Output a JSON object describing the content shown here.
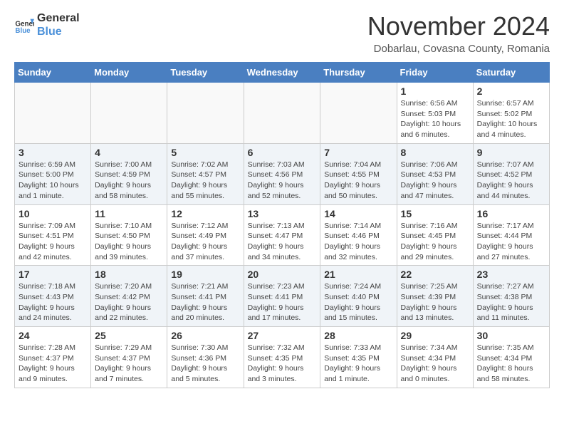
{
  "logo": {
    "line1": "General",
    "line2": "Blue"
  },
  "title": "November 2024",
  "location": "Dobarlau, Covasna County, Romania",
  "days_of_week": [
    "Sunday",
    "Monday",
    "Tuesday",
    "Wednesday",
    "Thursday",
    "Friday",
    "Saturday"
  ],
  "weeks": [
    [
      {
        "day": "",
        "info": ""
      },
      {
        "day": "",
        "info": ""
      },
      {
        "day": "",
        "info": ""
      },
      {
        "day": "",
        "info": ""
      },
      {
        "day": "",
        "info": ""
      },
      {
        "day": "1",
        "info": "Sunrise: 6:56 AM\nSunset: 5:03 PM\nDaylight: 10 hours and 6 minutes."
      },
      {
        "day": "2",
        "info": "Sunrise: 6:57 AM\nSunset: 5:02 PM\nDaylight: 10 hours and 4 minutes."
      }
    ],
    [
      {
        "day": "3",
        "info": "Sunrise: 6:59 AM\nSunset: 5:00 PM\nDaylight: 10 hours and 1 minute."
      },
      {
        "day": "4",
        "info": "Sunrise: 7:00 AM\nSunset: 4:59 PM\nDaylight: 9 hours and 58 minutes."
      },
      {
        "day": "5",
        "info": "Sunrise: 7:02 AM\nSunset: 4:57 PM\nDaylight: 9 hours and 55 minutes."
      },
      {
        "day": "6",
        "info": "Sunrise: 7:03 AM\nSunset: 4:56 PM\nDaylight: 9 hours and 52 minutes."
      },
      {
        "day": "7",
        "info": "Sunrise: 7:04 AM\nSunset: 4:55 PM\nDaylight: 9 hours and 50 minutes."
      },
      {
        "day": "8",
        "info": "Sunrise: 7:06 AM\nSunset: 4:53 PM\nDaylight: 9 hours and 47 minutes."
      },
      {
        "day": "9",
        "info": "Sunrise: 7:07 AM\nSunset: 4:52 PM\nDaylight: 9 hours and 44 minutes."
      }
    ],
    [
      {
        "day": "10",
        "info": "Sunrise: 7:09 AM\nSunset: 4:51 PM\nDaylight: 9 hours and 42 minutes."
      },
      {
        "day": "11",
        "info": "Sunrise: 7:10 AM\nSunset: 4:50 PM\nDaylight: 9 hours and 39 minutes."
      },
      {
        "day": "12",
        "info": "Sunrise: 7:12 AM\nSunset: 4:49 PM\nDaylight: 9 hours and 37 minutes."
      },
      {
        "day": "13",
        "info": "Sunrise: 7:13 AM\nSunset: 4:47 PM\nDaylight: 9 hours and 34 minutes."
      },
      {
        "day": "14",
        "info": "Sunrise: 7:14 AM\nSunset: 4:46 PM\nDaylight: 9 hours and 32 minutes."
      },
      {
        "day": "15",
        "info": "Sunrise: 7:16 AM\nSunset: 4:45 PM\nDaylight: 9 hours and 29 minutes."
      },
      {
        "day": "16",
        "info": "Sunrise: 7:17 AM\nSunset: 4:44 PM\nDaylight: 9 hours and 27 minutes."
      }
    ],
    [
      {
        "day": "17",
        "info": "Sunrise: 7:18 AM\nSunset: 4:43 PM\nDaylight: 9 hours and 24 minutes."
      },
      {
        "day": "18",
        "info": "Sunrise: 7:20 AM\nSunset: 4:42 PM\nDaylight: 9 hours and 22 minutes."
      },
      {
        "day": "19",
        "info": "Sunrise: 7:21 AM\nSunset: 4:41 PM\nDaylight: 9 hours and 20 minutes."
      },
      {
        "day": "20",
        "info": "Sunrise: 7:23 AM\nSunset: 4:41 PM\nDaylight: 9 hours and 17 minutes."
      },
      {
        "day": "21",
        "info": "Sunrise: 7:24 AM\nSunset: 4:40 PM\nDaylight: 9 hours and 15 minutes."
      },
      {
        "day": "22",
        "info": "Sunrise: 7:25 AM\nSunset: 4:39 PM\nDaylight: 9 hours and 13 minutes."
      },
      {
        "day": "23",
        "info": "Sunrise: 7:27 AM\nSunset: 4:38 PM\nDaylight: 9 hours and 11 minutes."
      }
    ],
    [
      {
        "day": "24",
        "info": "Sunrise: 7:28 AM\nSunset: 4:37 PM\nDaylight: 9 hours and 9 minutes."
      },
      {
        "day": "25",
        "info": "Sunrise: 7:29 AM\nSunset: 4:37 PM\nDaylight: 9 hours and 7 minutes."
      },
      {
        "day": "26",
        "info": "Sunrise: 7:30 AM\nSunset: 4:36 PM\nDaylight: 9 hours and 5 minutes."
      },
      {
        "day": "27",
        "info": "Sunrise: 7:32 AM\nSunset: 4:35 PM\nDaylight: 9 hours and 3 minutes."
      },
      {
        "day": "28",
        "info": "Sunrise: 7:33 AM\nSunset: 4:35 PM\nDaylight: 9 hours and 1 minute."
      },
      {
        "day": "29",
        "info": "Sunrise: 7:34 AM\nSunset: 4:34 PM\nDaylight: 9 hours and 0 minutes."
      },
      {
        "day": "30",
        "info": "Sunrise: 7:35 AM\nSunset: 4:34 PM\nDaylight: 8 hours and 58 minutes."
      }
    ]
  ]
}
